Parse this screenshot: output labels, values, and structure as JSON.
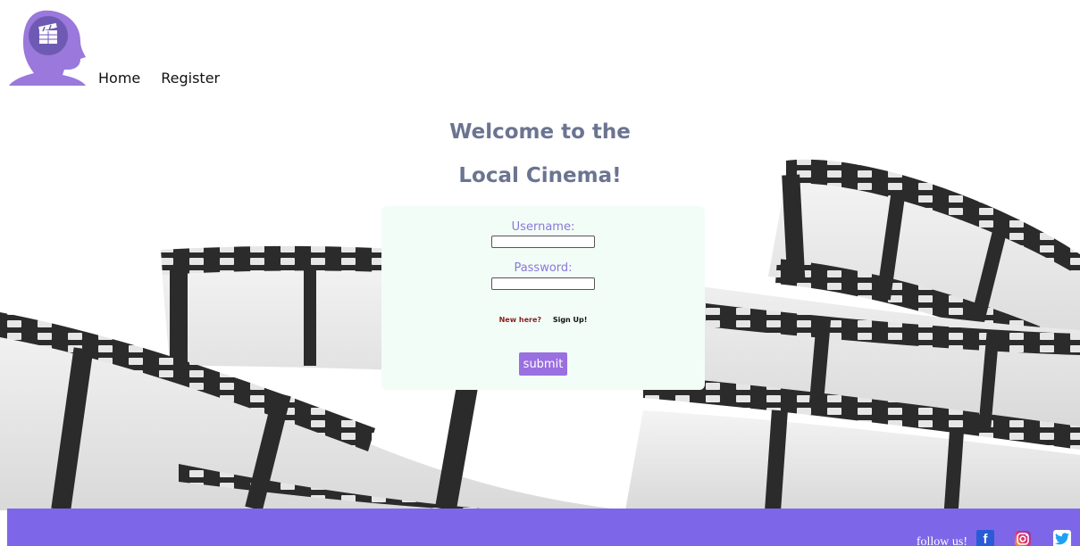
{
  "nav": {
    "items": [
      "Home",
      "Register"
    ]
  },
  "heading": {
    "line1": "Welcome to the",
    "line2": "Local Cinema!"
  },
  "login": {
    "username_label": "Username:",
    "username_value": "",
    "password_label": "Password:",
    "password_value": "",
    "new_here": "New here?",
    "sign_up": "Sign Up!",
    "submit_label": "submit"
  },
  "footer": {
    "follow_text": "follow us!",
    "social": [
      "facebook-icon",
      "instagram-icon",
      "twitter-icon"
    ]
  },
  "colors": {
    "accent_purple": "#7d67e8",
    "button_purple": "#9a6fe0",
    "heading_gray": "#6b7490",
    "card_bg": "#f2fdf7"
  }
}
